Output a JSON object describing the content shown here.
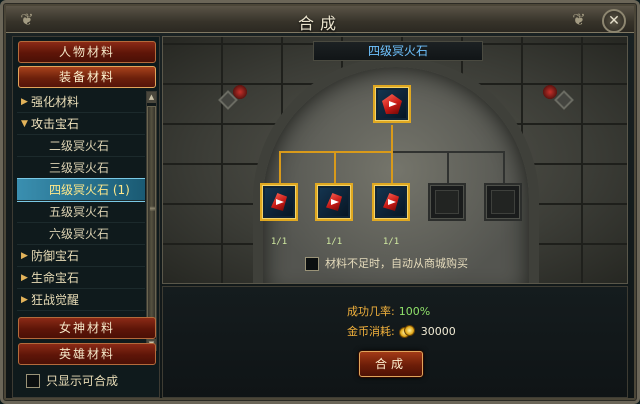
{
  "window": {
    "title": "合成",
    "close_label": "✕"
  },
  "categories": {
    "character": "人物材料",
    "equipment": "装备材料",
    "goddess": "女神材料",
    "hero": "英雄材料"
  },
  "tree": {
    "items": [
      {
        "label": "强化材料",
        "arrow": "▶"
      },
      {
        "label": "攻击宝石",
        "arrow": "▼"
      },
      {
        "label": "二级冥火石"
      },
      {
        "label": "三级冥火石"
      },
      {
        "label": "四级冥火石 (1)"
      },
      {
        "label": "五级冥火石"
      },
      {
        "label": "六级冥火石"
      },
      {
        "label": "防御宝石",
        "arrow": "▶"
      },
      {
        "label": "生命宝石",
        "arrow": "▶"
      },
      {
        "label": "狂战觉醒",
        "arrow": "▶"
      }
    ],
    "selected_index": 4
  },
  "filter": {
    "only_craftable_label": "只显示可合成"
  },
  "recipe": {
    "title": "四级冥火石",
    "materials": [
      {
        "count": "1/1"
      },
      {
        "count": "1/1"
      },
      {
        "count": "1/1"
      }
    ],
    "autobuy_label": "材料不足时，自动从商城购买"
  },
  "info": {
    "success_label": "成功几率:",
    "success_value": "100%",
    "cost_label": "金币消耗:",
    "cost_value": "30000"
  },
  "actions": {
    "craft_label": "合成"
  },
  "colors": {
    "accent_gold": "#d99a1a",
    "title_blue": "#6fc3ff",
    "success_green": "#8fe06a",
    "label_orange": "#f0b03c",
    "button_red": "#6d1d08"
  }
}
